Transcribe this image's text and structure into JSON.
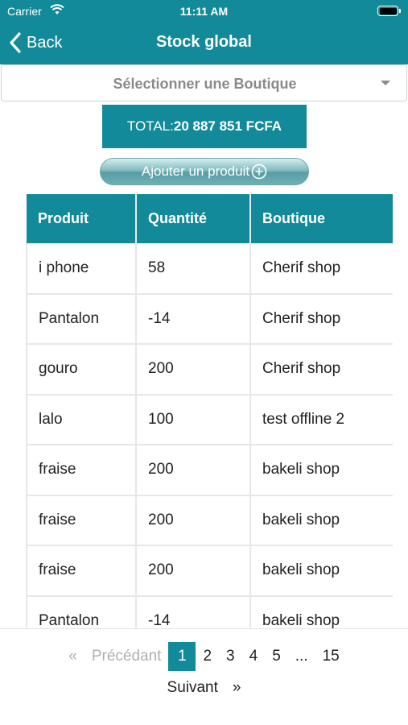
{
  "status_bar": {
    "carrier": "Carrier",
    "time": "11:11 AM",
    "wifi_icon": "wifi-icon",
    "battery_icon": "battery-icon"
  },
  "nav": {
    "back_label": "Back",
    "title": "Stock global"
  },
  "shop_select": {
    "placeholder": "Sélectionner une Boutique"
  },
  "total": {
    "label": "TOTAL:",
    "value": "20 887 851 FCFA"
  },
  "add_product": {
    "label": "Ajouter un produit",
    "icon": "plus-circle-icon"
  },
  "table": {
    "columns": [
      "Produit",
      "Quantité",
      "Boutique"
    ],
    "rows": [
      [
        "i phone",
        "58",
        "Cherif shop"
      ],
      [
        "Pantalon",
        "-14",
        "Cherif shop"
      ],
      [
        "gouro",
        "200",
        "Cherif shop"
      ],
      [
        "lalo",
        "100",
        "test offline 2"
      ],
      [
        "fraise",
        "200",
        "bakeli shop"
      ],
      [
        "fraise",
        "200",
        "bakeli shop"
      ],
      [
        "fraise",
        "200",
        "bakeli shop"
      ],
      [
        "Pantalon",
        "-14",
        "bakeli shop"
      ]
    ]
  },
  "pagination": {
    "first": "«",
    "previous": "Précédant",
    "pages": [
      "1",
      "2",
      "3",
      "4",
      "5",
      "...",
      "15"
    ],
    "current": "1",
    "next": "Suivant",
    "last": "»"
  },
  "colors": {
    "primary": "#138a99",
    "border": "#e5e8ea",
    "muted": "#8a8a8a"
  }
}
